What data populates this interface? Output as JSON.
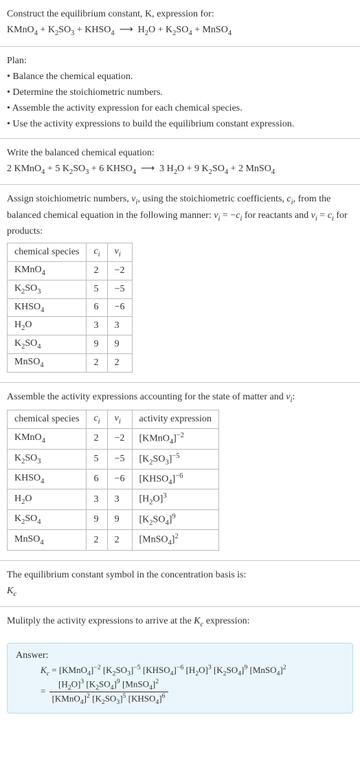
{
  "intro": {
    "l1": "Construct the equilibrium constant, K, expression for:",
    "l2_html": "KMnO<sub>4</sub> + K<sub>2</sub>SO<sub>3</sub> + KHSO<sub>4</sub> &nbsp;⟶&nbsp; H<sub>2</sub>O + K<sub>2</sub>SO<sub>4</sub> + MnSO<sub>4</sub>"
  },
  "plan": {
    "title": "Plan:",
    "b1": "• Balance the chemical equation.",
    "b2": "• Determine the stoichiometric numbers.",
    "b3": "• Assemble the activity expression for each chemical species.",
    "b4": "• Use the activity expressions to build the equilibrium constant expression."
  },
  "balanced": {
    "title": "Write the balanced chemical equation:",
    "eq_html": "2 KMnO<sub>4</sub> + 5 K<sub>2</sub>SO<sub>3</sub> + 6 KHSO<sub>4</sub> &nbsp;⟶&nbsp; 3 H<sub>2</sub>O + 9 K<sub>2</sub>SO<sub>4</sub> + 2 MnSO<sub>4</sub>"
  },
  "stoich": {
    "par_html": "Assign stoichiometric numbers, <span class='italic'>ν<sub>i</sub></span>, using the stoichiometric coefficients, <span class='italic'>c<sub>i</sub></span>, from the balanced chemical equation in the following manner: <span class='italic'>ν<sub>i</sub></span> = −<span class='italic'>c<sub>i</sub></span> for reactants and <span class='italic'>ν<sub>i</sub></span> = <span class='italic'>c<sub>i</sub></span> for products:",
    "headers": {
      "h1": "chemical species",
      "h2_html": "<span class='italic'>c<sub>i</sub></span>",
      "h3_html": "<span class='italic'>ν<sub>i</sub></span>"
    },
    "rows": [
      {
        "sp_html": "KMnO<sub>4</sub>",
        "c": "2",
        "v": "−2"
      },
      {
        "sp_html": "K<sub>2</sub>SO<sub>3</sub>",
        "c": "5",
        "v": "−5"
      },
      {
        "sp_html": "KHSO<sub>4</sub>",
        "c": "6",
        "v": "−6"
      },
      {
        "sp_html": "H<sub>2</sub>O",
        "c": "3",
        "v": "3"
      },
      {
        "sp_html": "K<sub>2</sub>SO<sub>4</sub>",
        "c": "9",
        "v": "9"
      },
      {
        "sp_html": "MnSO<sub>4</sub>",
        "c": "2",
        "v": "2"
      }
    ]
  },
  "activity": {
    "par_html": "Assemble the activity expressions accounting for the state of matter and <span class='italic'>ν<sub>i</sub></span>:",
    "headers": {
      "h1": "chemical species",
      "h2_html": "<span class='italic'>c<sub>i</sub></span>",
      "h3_html": "<span class='italic'>ν<sub>i</sub></span>",
      "h4": "activity expression"
    },
    "rows": [
      {
        "sp_html": "KMnO<sub>4</sub>",
        "c": "2",
        "v": "−2",
        "a_html": "[KMnO<sub>4</sub>]<sup>−2</sup>"
      },
      {
        "sp_html": "K<sub>2</sub>SO<sub>3</sub>",
        "c": "5",
        "v": "−5",
        "a_html": "[K<sub>2</sub>SO<sub>3</sub>]<sup>−5</sup>"
      },
      {
        "sp_html": "KHSO<sub>4</sub>",
        "c": "6",
        "v": "−6",
        "a_html": "[KHSO<sub>4</sub>]<sup>−6</sup>"
      },
      {
        "sp_html": "H<sub>2</sub>O",
        "c": "3",
        "v": "3",
        "a_html": "[H<sub>2</sub>O]<sup>3</sup>"
      },
      {
        "sp_html": "K<sub>2</sub>SO<sub>4</sub>",
        "c": "9",
        "v": "9",
        "a_html": "[K<sub>2</sub>SO<sub>4</sub>]<sup>9</sup>"
      },
      {
        "sp_html": "MnSO<sub>4</sub>",
        "c": "2",
        "v": "2",
        "a_html": "[MnSO<sub>4</sub>]<sup>2</sup>"
      }
    ]
  },
  "symbol": {
    "l1": "The equilibrium constant symbol in the concentration basis is:",
    "l2_html": "<span class='italic'>K<sub>c</sub></span>"
  },
  "multiply": {
    "l1_html": "Mulitply the activity expressions to arrive at the <span class='italic'>K<sub>c</sub></span> expression:"
  },
  "answer": {
    "label": "Answer:",
    "line1_html": "<span class='italic'>K<sub>c</sub></span> = [KMnO<sub>4</sub>]<sup>−2</sup> [K<sub>2</sub>SO<sub>3</sub>]<sup>−5</sup> [KHSO<sub>4</sub>]<sup>−6</sup> [H<sub>2</sub>O]<sup>3</sup> [K<sub>2</sub>SO<sub>4</sub>]<sup>9</sup> [MnSO<sub>4</sub>]<sup>2</sup>",
    "num_html": "[H<sub>2</sub>O]<sup>3</sup> [K<sub>2</sub>SO<sub>4</sub>]<sup>9</sup> [MnSO<sub>4</sub>]<sup>2</sup>",
    "den_html": "[KMnO<sub>4</sub>]<sup>2</sup> [K<sub>2</sub>SO<sub>3</sub>]<sup>5</sup> [KHSO<sub>4</sub>]<sup>6</sup>"
  }
}
